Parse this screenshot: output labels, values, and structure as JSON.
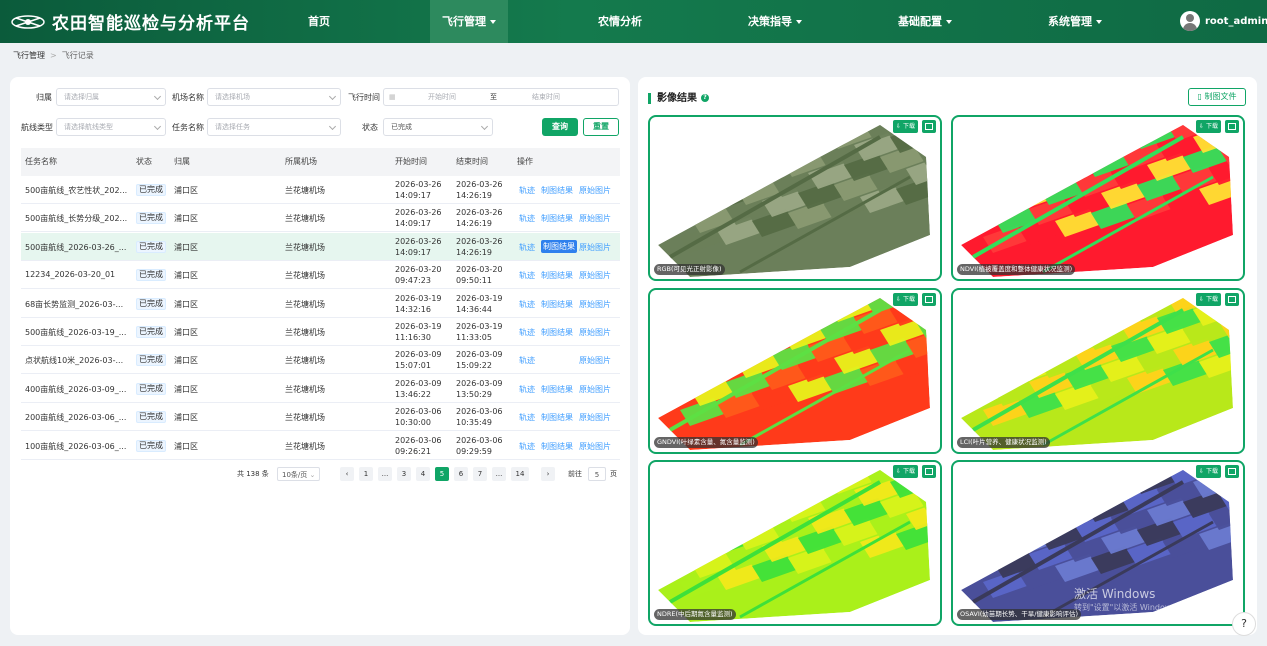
{
  "header": {
    "logo_icon": "drone-icon",
    "title": "农田智能巡检与分析平台",
    "nav": [
      {
        "label": "首页",
        "dropdown": false,
        "active": false
      },
      {
        "label": "飞行管理",
        "dropdown": true,
        "active": true
      },
      {
        "label": "农情分析",
        "dropdown": false,
        "active": false
      },
      {
        "label": "决策指导",
        "dropdown": true,
        "active": false
      },
      {
        "label": "基础配置",
        "dropdown": true,
        "active": false
      },
      {
        "label": "系统管理",
        "dropdown": true,
        "active": false
      }
    ],
    "username": "root_admin"
  },
  "breadcrumb": [
    "飞行管理",
    "飞行记录"
  ],
  "filters": {
    "area_label": "归属",
    "area_placeholder": "请选择归属",
    "airport_label": "机场名称",
    "airport_placeholder": "请选择机场",
    "time_label": "飞行时间",
    "start_placeholder": "开始时间",
    "to": "至",
    "end_placeholder": "结束时间",
    "route_label": "航线类型",
    "route_placeholder": "请选择航线类型",
    "task_label": "任务名称",
    "task_placeholder": "请选择任务",
    "status_label": "状态",
    "status_value": "已完成",
    "query": "查询",
    "reset": "重置"
  },
  "table": {
    "columns": [
      "任务名称",
      "状态",
      "归属",
      "所属机场",
      "开始时间",
      "结束时间",
      "操作"
    ],
    "rows": [
      {
        "name": "500亩航线_农艺性状_202...",
        "status": "已完成",
        "area": "浦口区",
        "airport": "兰花塘机场",
        "start_date": "2026-03-26",
        "start_time": "14:09:17",
        "end_date": "2026-03-26",
        "end_time": "14:26:19",
        "ops": [
          "轨迹",
          "制图结果",
          "原始图片"
        ]
      },
      {
        "name": "500亩航线_长势分级_202...",
        "status": "已完成",
        "area": "浦口区",
        "airport": "兰花塘机场",
        "start_date": "2026-03-26",
        "start_time": "14:09:17",
        "end_date": "2026-03-26",
        "end_time": "14:26:19",
        "ops": [
          "轨迹",
          "制图结果",
          "原始图片"
        ]
      },
      {
        "name": "500亩航线_2026-03-26_...",
        "status": "已完成",
        "area": "浦口区",
        "airport": "兰花塘机场",
        "start_date": "2026-03-26",
        "start_time": "14:09:17",
        "end_date": "2026-03-26",
        "end_time": "14:26:19",
        "ops": [
          "轨迹",
          "制图结果",
          "原始图片"
        ]
      },
      {
        "name": "12234_2026-03-20_01",
        "status": "已完成",
        "area": "浦口区",
        "airport": "兰花塘机场",
        "start_date": "2026-03-20",
        "start_time": "09:47:23",
        "end_date": "2026-03-20",
        "end_time": "09:50:11",
        "ops": [
          "轨迹",
          "制图结果",
          "原始图片"
        ]
      },
      {
        "name": "68亩长势监测_2026-03-...",
        "status": "已完成",
        "area": "浦口区",
        "airport": "兰花塘机场",
        "start_date": "2026-03-19",
        "start_time": "14:32:16",
        "end_date": "2026-03-19",
        "end_time": "14:36:44",
        "ops": [
          "轨迹",
          "制图结果",
          "原始图片"
        ]
      },
      {
        "name": "500亩航线_2026-03-19_...",
        "status": "已完成",
        "area": "浦口区",
        "airport": "兰花塘机场",
        "start_date": "2026-03-19",
        "start_time": "11:16:30",
        "end_date": "2026-03-19",
        "end_time": "11:33:05",
        "ops": [
          "轨迹",
          "制图结果",
          "原始图片"
        ]
      },
      {
        "name": "点状航线10米_2026-03-...",
        "status": "已完成",
        "area": "浦口区",
        "airport": "兰花塘机场",
        "start_date": "2026-03-09",
        "start_time": "15:07:01",
        "end_date": "2026-03-09",
        "end_time": "15:09:22",
        "ops": [
          "轨迹",
          "",
          "原始图片"
        ]
      },
      {
        "name": "400亩航线_2026-03-09_...",
        "status": "已完成",
        "area": "浦口区",
        "airport": "兰花塘机场",
        "start_date": "2026-03-09",
        "start_time": "13:46:22",
        "end_date": "2026-03-09",
        "end_time": "13:50:29",
        "ops": [
          "轨迹",
          "制图结果",
          "原始图片"
        ]
      },
      {
        "name": "200亩航线_2026-03-06_...",
        "status": "已完成",
        "area": "浦口区",
        "airport": "兰花塘机场",
        "start_date": "2026-03-06",
        "start_time": "10:30:00",
        "end_date": "2026-03-06",
        "end_time": "10:35:49",
        "ops": [
          "轨迹",
          "制图结果",
          "原始图片"
        ]
      },
      {
        "name": "100亩航线_2026-03-06_...",
        "status": "已完成",
        "area": "浦口区",
        "airport": "兰花塘机场",
        "start_date": "2026-03-06",
        "start_time": "09:26:21",
        "end_date": "2026-03-06",
        "end_time": "09:29:59",
        "ops": [
          "轨迹",
          "制图结果",
          "原始图片"
        ]
      }
    ],
    "selected_row": 2
  },
  "pagination": {
    "total": "共 138 条",
    "page_size": "10条/页",
    "pages": [
      "1",
      "...",
      "3",
      "4",
      "5",
      "6",
      "7",
      "...",
      "14"
    ],
    "current": "5",
    "goto_label": "前往",
    "goto_value": "5",
    "goto_unit": "页"
  },
  "results": {
    "title": "影像结果",
    "file_button": "制图文件",
    "download_label": "下载",
    "cards": [
      {
        "caption": "RGB(可见光正射影像)",
        "palette": [
          "#6b7f5a",
          "#8a9a72",
          "#556b45",
          "#9aa885"
        ]
      },
      {
        "caption": "NDVI(植被覆盖度和整体健康状况监测)",
        "palette": [
          "#ff1a2e",
          "#ff3a3a",
          "#33e05a",
          "#ffe233"
        ]
      },
      {
        "caption": "GNDVI(叶绿素含量、氮含量监测)",
        "palette": [
          "#ff3a1a",
          "#ff5a1a",
          "#5de043",
          "#e8f21a"
        ]
      },
      {
        "caption": "LCI(叶片营养、健康状况监测)",
        "palette": [
          "#b8e81a",
          "#e6f01a",
          "#3ee04a",
          "#ffd21a"
        ]
      },
      {
        "caption": "NDRE(中后期氮含量监测)",
        "palette": [
          "#aaf01a",
          "#d8f21a",
          "#3ee03a",
          "#f2e81a"
        ]
      },
      {
        "caption": "OSAVI(幼苗期长势、干旱/健康影响评估)",
        "palette": [
          "#4a4f9a",
          "#5a66c8",
          "#3a3a5a",
          "#6a7ad0"
        ]
      }
    ]
  },
  "watermark": {
    "line1": "激活 Windows",
    "line2": "转到\"设置\"以激活 Windows。"
  },
  "help": "?"
}
